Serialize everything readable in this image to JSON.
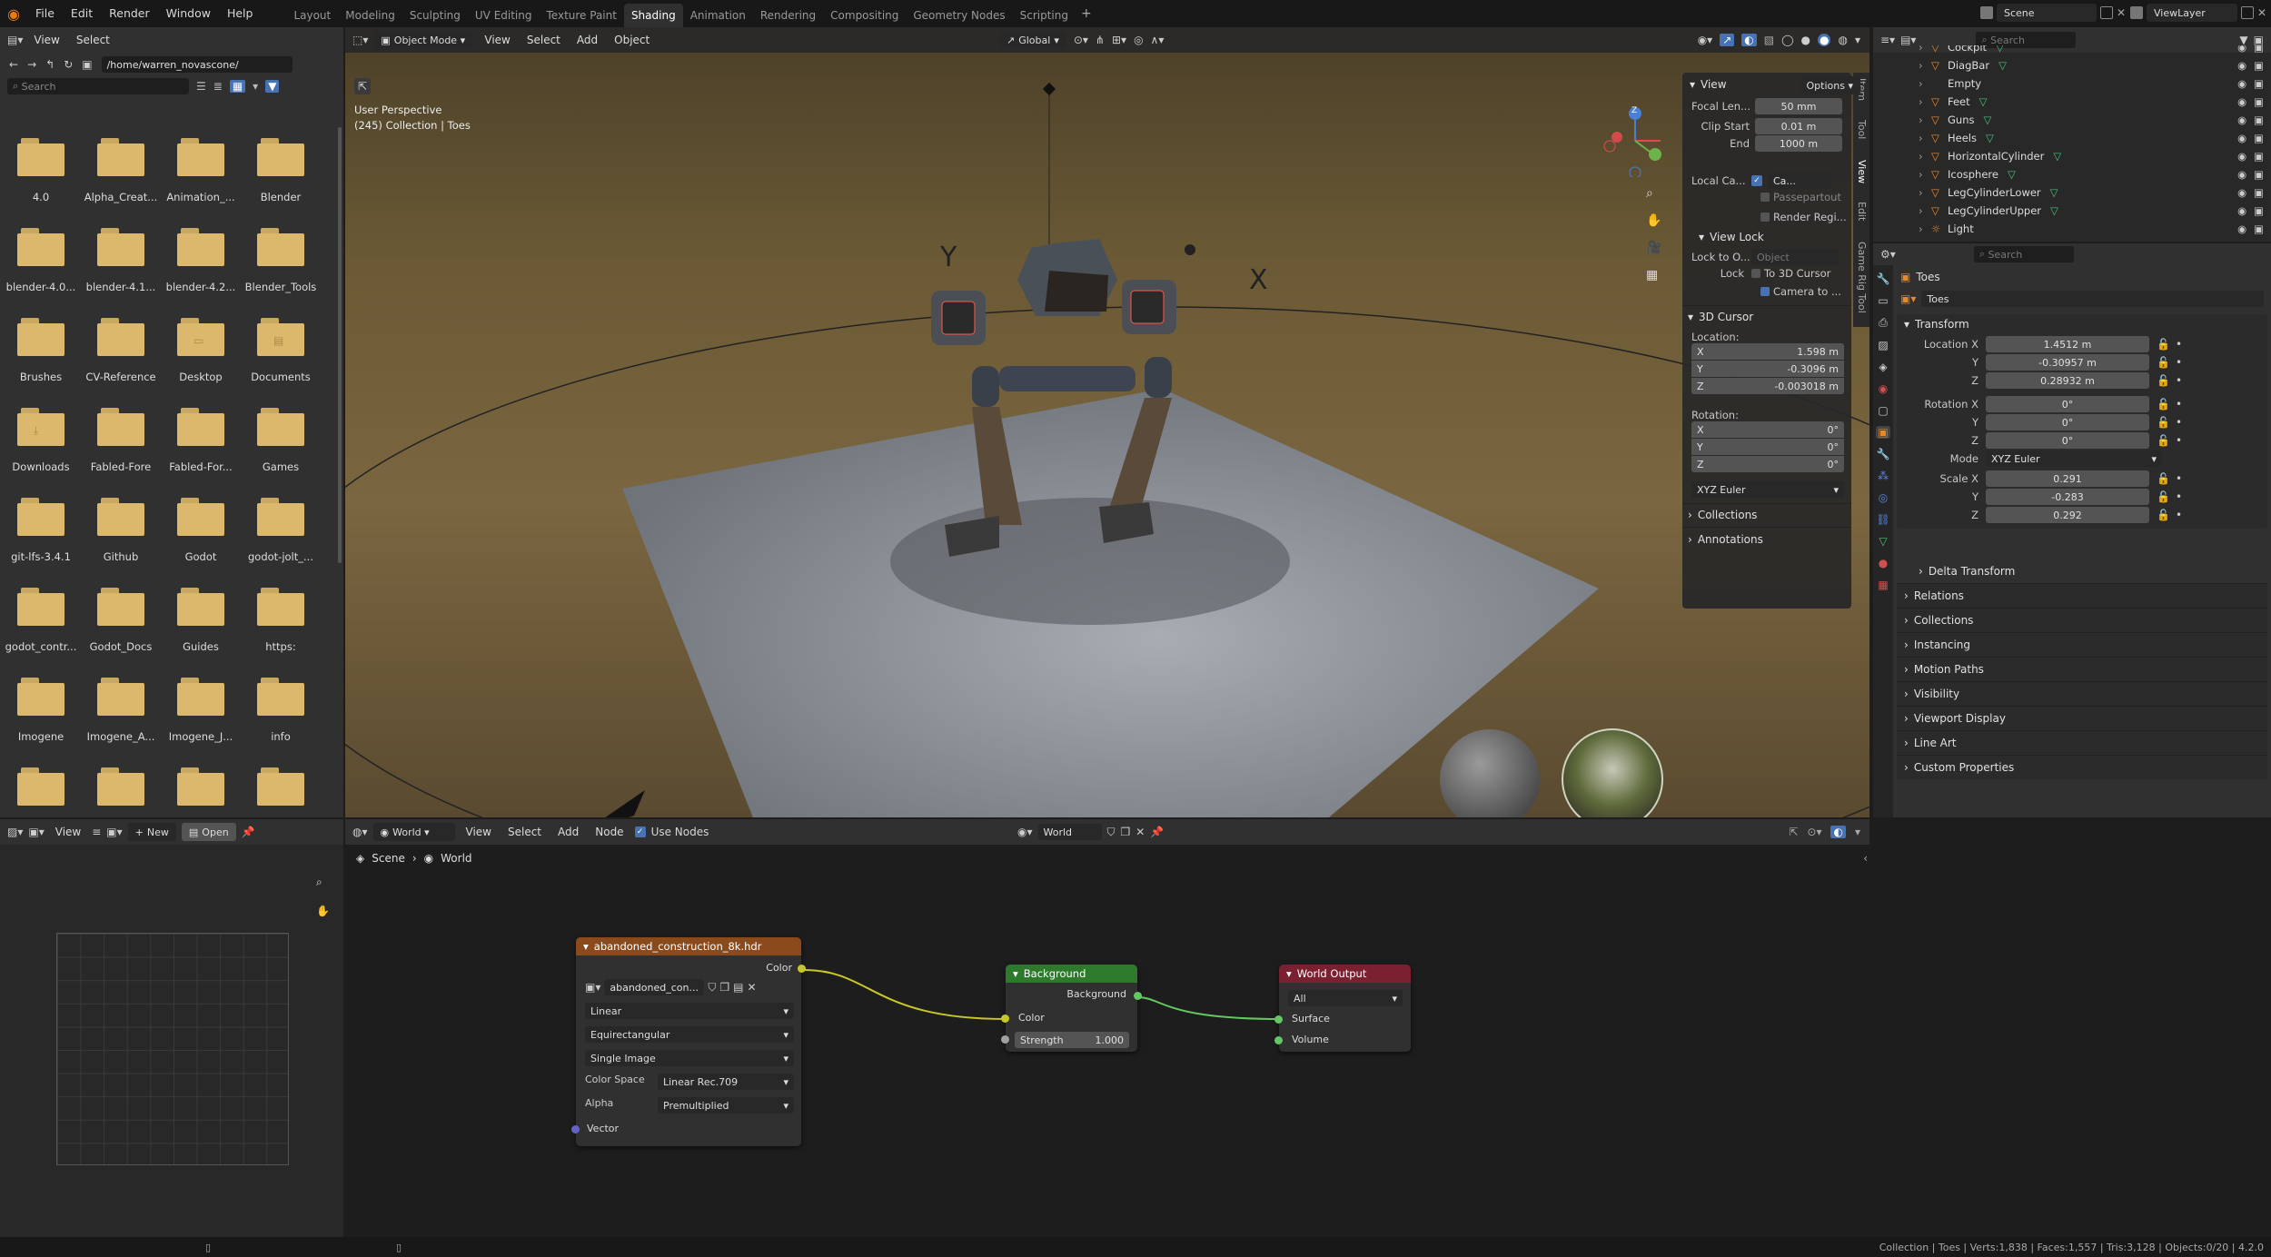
{
  "topbar": {
    "menus": [
      "File",
      "Edit",
      "Render",
      "Window",
      "Help"
    ],
    "workspaces": [
      "Layout",
      "Modeling",
      "Sculpting",
      "UV Editing",
      "Texture Paint",
      "Shading",
      "Animation",
      "Rendering",
      "Compositing",
      "Geometry Nodes",
      "Scripting"
    ],
    "active_workspace": "Shading",
    "scene_name": "Scene",
    "viewlayer_name": "ViewLayer"
  },
  "filebrowser": {
    "menus": [
      "View",
      "Select"
    ],
    "path": "/home/warren_novascone/",
    "search_placeholder": "Search",
    "items": [
      {
        "name": "4.0",
        "kind": "folder"
      },
      {
        "name": "Alpha_Creat...",
        "kind": "folder"
      },
      {
        "name": "Animation_...",
        "kind": "folder"
      },
      {
        "name": "Blender",
        "kind": "folder"
      },
      {
        "name": "blender-4.0...",
        "kind": "folder"
      },
      {
        "name": "blender-4.1...",
        "kind": "folder"
      },
      {
        "name": "blender-4.2...",
        "kind": "folder"
      },
      {
        "name": "Blender_Tools",
        "kind": "folder"
      },
      {
        "name": "Brushes",
        "kind": "folder"
      },
      {
        "name": "CV-Reference",
        "kind": "folder"
      },
      {
        "name": "Desktop",
        "kind": "folder-desktop"
      },
      {
        "name": "Documents",
        "kind": "folder-documents"
      },
      {
        "name": "Downloads",
        "kind": "folder-downloads"
      },
      {
        "name": "Fabled-Fore",
        "kind": "folder"
      },
      {
        "name": "Fabled-For...",
        "kind": "folder"
      },
      {
        "name": "Games",
        "kind": "folder"
      },
      {
        "name": "git-lfs-3.4.1",
        "kind": "folder"
      },
      {
        "name": "Github",
        "kind": "folder"
      },
      {
        "name": "Godot",
        "kind": "folder"
      },
      {
        "name": "godot-jolt_...",
        "kind": "folder"
      },
      {
        "name": "godot_contr...",
        "kind": "folder"
      },
      {
        "name": "Godot_Docs",
        "kind": "folder"
      },
      {
        "name": "Guides",
        "kind": "folder"
      },
      {
        "name": "https:",
        "kind": "folder"
      },
      {
        "name": "Imogene",
        "kind": "folder"
      },
      {
        "name": "Imogene_A...",
        "kind": "folder"
      },
      {
        "name": "Imogene_J...",
        "kind": "folder"
      },
      {
        "name": "info",
        "kind": "folder"
      },
      {
        "name": "",
        "kind": "folder"
      },
      {
        "name": "",
        "kind": "folder"
      },
      {
        "name": "",
        "kind": "folder"
      },
      {
        "name": "",
        "kind": "folder"
      }
    ]
  },
  "viewport": {
    "mode": "Object Mode",
    "menus": [
      "View",
      "Select",
      "Add",
      "Object"
    ],
    "orientation": "Global",
    "overlay_title": "User Perspective",
    "overlay_sub": "(245) Collection | Toes",
    "options_label": "Options",
    "npanel": {
      "view_header": "View",
      "focal_label": "Focal Len...",
      "focal_value": "50 mm",
      "clip_start_label": "Clip Start",
      "clip_start_value": "0.01 m",
      "end_label": "End",
      "end_value": "1000 m",
      "local_camera_label": "Local Ca...",
      "local_camera_value": "Ca...",
      "passepartout_label": "Passepartout",
      "render_region_label": "Render Regi...",
      "view_lock_header": "View Lock",
      "lock_to_object_label": "Lock to O...",
      "lock_object_placeholder": "Object",
      "lock_label": "Lock",
      "to_3d_cursor_label": "To 3D Cursor",
      "camera_to_label": "Camera to ...",
      "cursor_header": "3D Cursor",
      "location_label": "Location:",
      "loc_x": "1.598 m",
      "loc_y": "-0.3096 m",
      "loc_z": "-0.003018 m",
      "rotation_label": "Rotation:",
      "rot_x": "0°",
      "rot_y": "0°",
      "rot_z": "0°",
      "rot_mode": "XYZ Euler",
      "collections_header": "Collections",
      "annotations_header": "Annotations",
      "axis_x": "X",
      "axis_y": "Y",
      "axis_z": "Z"
    },
    "side_tabs": [
      "Item",
      "Tool",
      "View",
      "Edit",
      "Game Rig Tool"
    ]
  },
  "outliner": {
    "search_placeholder": "Search",
    "rows": [
      {
        "name": "Cockpit",
        "icon": "mesh-object-icon"
      },
      {
        "name": "DiagBar",
        "icon": "mesh-object-icon"
      },
      {
        "name": "Empty",
        "icon": "empty-icon"
      },
      {
        "name": "Feet",
        "icon": "mesh-object-icon"
      },
      {
        "name": "Guns",
        "icon": "mesh-object-icon"
      },
      {
        "name": "Heels",
        "icon": "mesh-object-icon"
      },
      {
        "name": "HorizontalCylinder",
        "icon": "mesh-object-icon"
      },
      {
        "name": "Icosphere",
        "icon": "mesh-object-icon"
      },
      {
        "name": "LegCylinderLower",
        "icon": "mesh-object-icon"
      },
      {
        "name": "LegCylinderUpper",
        "icon": "mesh-object-icon"
      },
      {
        "name": "Light",
        "icon": "light-icon"
      }
    ]
  },
  "properties": {
    "search_placeholder": "Search",
    "object_name": "Toes",
    "datablock_name": "Toes",
    "transform_header": "Transform",
    "location_x_label": "Location X",
    "y_label": "Y",
    "z_label": "Z",
    "loc_x": "1.4512 m",
    "loc_y": "-0.30957 m",
    "loc_z": "0.28932 m",
    "rotation_x_label": "Rotation X",
    "rot_x": "0°",
    "rot_y": "0°",
    "rot_z": "0°",
    "mode_label": "Mode",
    "mode_value": "XYZ Euler",
    "scale_x_label": "Scale X",
    "scale_x": "0.291",
    "scale_y": "-0.283",
    "scale_z": "0.292",
    "delta_header": "Delta Transform",
    "sections": [
      "Relations",
      "Collections",
      "Instancing",
      "Motion Paths",
      "Visibility",
      "Viewport Display",
      "Line Art",
      "Custom Properties"
    ]
  },
  "image_editor": {
    "view_label": "View",
    "new_label": "New",
    "open_label": "Open"
  },
  "node_editor": {
    "world_label": "World",
    "menus": [
      "View",
      "Select",
      "Add",
      "Node"
    ],
    "use_nodes_label": "Use Nodes",
    "world_name": "World",
    "breadcrumb_scene": "Scene",
    "breadcrumb_world": "World",
    "env_node": {
      "title": "abandoned_construction_8k.hdr",
      "color_out": "Color",
      "image_name": "abandoned_con...",
      "interp": "Linear",
      "projection": "Equirectangular",
      "source": "Single Image",
      "color_space_label": "Color Space",
      "color_space": "Linear Rec.709",
      "alpha_label": "Alpha",
      "alpha": "Premultiplied",
      "vector_in": "Vector"
    },
    "bg_node": {
      "title": "Background",
      "out": "Background",
      "color_in": "Color",
      "strength_label": "Strength",
      "strength_value": "1.000"
    },
    "out_node": {
      "title": "World Output",
      "target": "All",
      "surface": "Surface",
      "volume": "Volume"
    }
  },
  "statusbar": {
    "text": "Collection | Toes | Verts:1,838 | Faces:1,557 | Tris:3,128 | Objects:0/20 | 4.2.0"
  },
  "colors": {
    "accent": "#4772b3",
    "env_node_header": "#8a4a1c",
    "bg_node_header": "#2d7a2d",
    "out_node_header": "#7a2030",
    "color_socket": "#c7c729",
    "shader_socket": "#63c763",
    "vector_socket": "#6363c7"
  }
}
